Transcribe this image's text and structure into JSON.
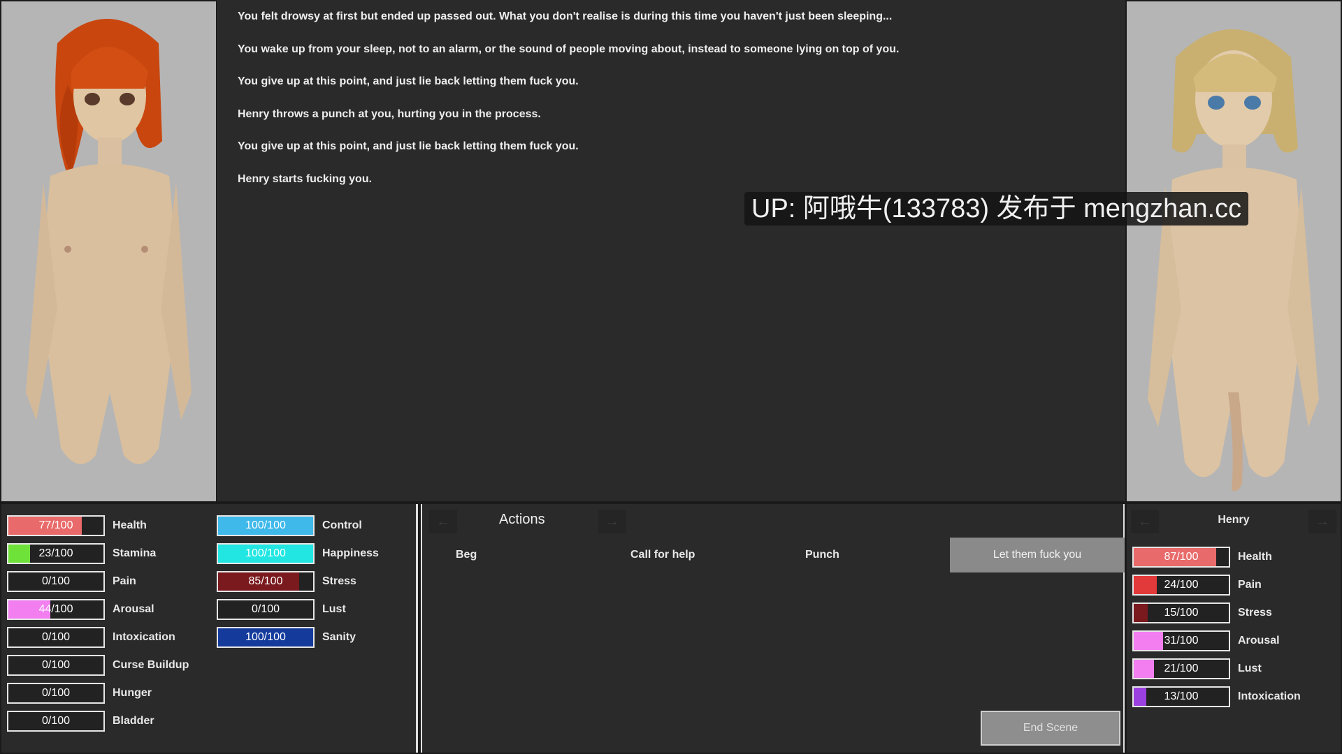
{
  "log": [
    "You felt drowsy at first but ended up passed out. What you don't realise is during this time you haven't just been sleeping...",
    "You wake up from your sleep, not to an alarm, or the sound of people moving about, instead to someone lying on top of you.",
    "You give up at this point, and just lie back letting them fuck you.",
    "Henry throws a punch at you, hurting you in the process.",
    "You give up at this point, and just lie back letting them fuck you.",
    "Henry starts fucking you."
  ],
  "watermark": "UP: 阿哦牛(133783) 发布于 mengzhan.cc",
  "player_stats": [
    {
      "label": "Health",
      "value": "77/100",
      "fraction": 0.77,
      "color": "#e86a6a"
    },
    {
      "label": "Stamina",
      "value": "23/100",
      "fraction": 0.23,
      "color": "#6fe23a"
    },
    {
      "label": "Pain",
      "value": "0/100",
      "fraction": 0,
      "color": "#e04040"
    },
    {
      "label": "Arousal",
      "value": "44/100",
      "fraction": 0.44,
      "color": "#f27ef0"
    },
    {
      "label": "Intoxication",
      "value": "0/100",
      "fraction": 0,
      "color": "#9b40e0"
    },
    {
      "label": "Curse Buildup",
      "value": "0/100",
      "fraction": 0,
      "color": "#888888"
    },
    {
      "label": "Hunger",
      "value": "0/100",
      "fraction": 0,
      "color": "#888888"
    },
    {
      "label": "Bladder",
      "value": "0/100",
      "fraction": 0,
      "color": "#888888"
    }
  ],
  "player_stats_2": [
    {
      "label": "Control",
      "value": "100/100",
      "fraction": 1.0,
      "color": "#3fb8ea"
    },
    {
      "label": "Happiness",
      "value": "100/100",
      "fraction": 1.0,
      "color": "#22e6e2"
    },
    {
      "label": "Stress",
      "value": "85/100",
      "fraction": 0.85,
      "color": "#7a1a1e"
    },
    {
      "label": "Lust",
      "value": "0/100",
      "fraction": 0,
      "color": "#e06be0"
    },
    {
      "label": "Sanity",
      "value": "100/100",
      "fraction": 1.0,
      "color": "#143a9c"
    }
  ],
  "actions": {
    "title": "Actions",
    "prev_arrow": "←",
    "next_arrow": "→",
    "buttons": [
      "Beg",
      "Call for help",
      "Punch",
      "Let them fuck you"
    ],
    "end_scene": "End Scene"
  },
  "npc": {
    "name": "Henry",
    "prev_arrow": "←",
    "next_arrow": "→",
    "stats": [
      {
        "label": "Health",
        "value": "87/100",
        "fraction": 0.87,
        "color": "#e86a6a"
      },
      {
        "label": "Pain",
        "value": "24/100",
        "fraction": 0.24,
        "color": "#e23a3a"
      },
      {
        "label": "Stress",
        "value": "15/100",
        "fraction": 0.15,
        "color": "#7a1a1e"
      },
      {
        "label": "Arousal",
        "value": "31/100",
        "fraction": 0.31,
        "color": "#f27ef0"
      },
      {
        "label": "Lust",
        "value": "21/100",
        "fraction": 0.21,
        "color": "#f27ef0"
      },
      {
        "label": "Intoxication",
        "value": "13/100",
        "fraction": 0.13,
        "color": "#9b40e0"
      }
    ]
  }
}
